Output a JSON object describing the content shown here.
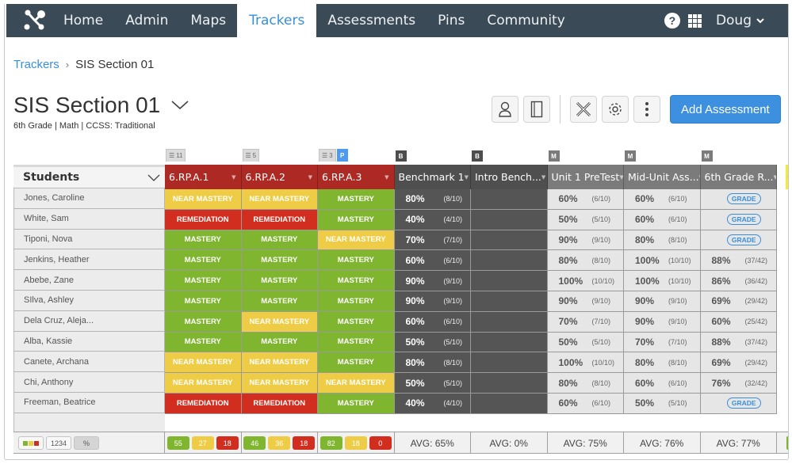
{
  "nav": {
    "items": [
      {
        "label": "Home",
        "active": false
      },
      {
        "label": "Admin",
        "active": false
      },
      {
        "label": "Maps",
        "active": false
      },
      {
        "label": "Trackers",
        "active": true
      },
      {
        "label": "Assessments",
        "active": false
      },
      {
        "label": "Pins",
        "active": false
      },
      {
        "label": "Community",
        "active": false
      }
    ],
    "help_icon": "?",
    "user_name": "Doug"
  },
  "breadcrumb": {
    "link": "Trackers",
    "separator": "›",
    "current": "SIS Section 01"
  },
  "page": {
    "title": "SIS Section 01",
    "subtitle": "6th Grade  |  Math  |  CCSS: Traditional"
  },
  "toolbar": {
    "icons": [
      "student-icon",
      "notebook-icon",
      "tools-icon",
      "gear-icon",
      "more-icon"
    ],
    "add_assessment_label": "Add Assessment"
  },
  "grid": {
    "students_header": "Students",
    "students": [
      "Jones, Caroline",
      "White, Sam",
      "Tiponi, Nova",
      "Jenkins, Heather",
      "Abebe, Zane",
      "SIlva, Ashley",
      "Dela Cruz, Aleja...",
      "Alba, Kassie",
      "Canete, Archana",
      "Chi, Anthony",
      "Freeman, Beatrice"
    ],
    "level_labels": {
      "m": "MASTERY",
      "n": "NEAR MASTERY",
      "r": "REMEDIATION"
    },
    "grade_label": "GRADE",
    "standards": [
      {
        "name": "6.RP.A.1",
        "count": "11",
        "pin": "",
        "levels": [
          "n",
          "r",
          "m",
          "m",
          "m",
          "m",
          "m",
          "m",
          "n",
          "n",
          "r"
        ],
        "summary": [
          "55",
          "27",
          "18"
        ]
      },
      {
        "name": "6.RP.A.2",
        "count": "5",
        "pin": "",
        "levels": [
          "n",
          "r",
          "m",
          "m",
          "m",
          "m",
          "n",
          "m",
          "n",
          "n",
          "r"
        ],
        "summary": [
          "46",
          "36",
          "18"
        ]
      },
      {
        "name": "6.RP.A.3",
        "count": "3",
        "pin": "P",
        "levels": [
          "m",
          "m",
          "n",
          "m",
          "m",
          "m",
          "m",
          "m",
          "m",
          "n",
          "m"
        ],
        "summary": [
          "82",
          "18",
          "0"
        ]
      }
    ],
    "assessments": [
      {
        "name": "Benchmark 1",
        "type": "B",
        "style": "bm",
        "avg": "AVG: 65%",
        "scores": [
          [
            "80%",
            "(8/10)"
          ],
          [
            "40%",
            "(4/10)"
          ],
          [
            "70%",
            "(7/10)"
          ],
          [
            "60%",
            "(6/10)"
          ],
          [
            "90%",
            "(9/10)"
          ],
          [
            "90%",
            "(9/10)"
          ],
          [
            "60%",
            "(6/10)"
          ],
          [
            "50%",
            "(5/10)"
          ],
          [
            "80%",
            "(8/10)"
          ],
          [
            "50%",
            "(5/10)"
          ],
          [
            "40%",
            "(4/10)"
          ]
        ]
      },
      {
        "name": "Intro Bench...",
        "type": "B",
        "style": "bm",
        "avg": "AVG: 0%",
        "scores": [
          null,
          null,
          null,
          null,
          null,
          null,
          null,
          null,
          null,
          null,
          null
        ]
      },
      {
        "name": "Unit 1 PreTest",
        "type": "M",
        "style": "mu",
        "avg": "AVG: 75%",
        "scores": [
          [
            "60%",
            "(6/10)"
          ],
          [
            "50%",
            "(5/10)"
          ],
          [
            "90%",
            "(9/10)"
          ],
          [
            "80%",
            "(8/10)"
          ],
          [
            "100%",
            "(10/10)"
          ],
          [
            "90%",
            "(9/10)"
          ],
          [
            "70%",
            "(7/10)"
          ],
          [
            "50%",
            "(5/10)"
          ],
          [
            "100%",
            "(10/10)"
          ],
          [
            "80%",
            "(8/10)"
          ],
          [
            "60%",
            "(6/10)"
          ]
        ]
      },
      {
        "name": "Mid-Unit Ass...",
        "type": "M",
        "style": "mu",
        "avg": "AVG: 76%",
        "scores": [
          [
            "60%",
            "(6/10)"
          ],
          [
            "60%",
            "(6/10)"
          ],
          [
            "80%",
            "(8/10)"
          ],
          [
            "100%",
            "(10/10)"
          ],
          [
            "100%",
            "(10/10)"
          ],
          [
            "90%",
            "(9/10)"
          ],
          [
            "90%",
            "(9/10)"
          ],
          [
            "70%",
            "(7/10)"
          ],
          [
            "80%",
            "(8/10)"
          ],
          [
            "60%",
            "(6/10)"
          ],
          [
            "50%",
            "(5/10)"
          ]
        ]
      },
      {
        "name": "6th Grade R...",
        "type": "M",
        "style": "mu",
        "avg": "AVG: 77%",
        "scores": [
          "GRADE",
          "GRADE",
          "GRADE",
          [
            "88%",
            "(37/42)"
          ],
          [
            "86%",
            "(36/42)"
          ],
          [
            "69%",
            "(29/42)"
          ],
          [
            "60%",
            "(25/42)"
          ],
          [
            "88%",
            "(37/42)"
          ],
          [
            "69%",
            "(29/42)"
          ],
          [
            "76%",
            "(32/42)"
          ],
          "GRADE"
        ]
      }
    ],
    "partial_next_column": "6",
    "footer_view_buttons": [
      "color-squares",
      "1234",
      "%"
    ]
  },
  "colors": {
    "mastery": "#7fb52f",
    "near_mastery": "#eecc45",
    "remediation": "#d12e20",
    "standard_header": "#ad2a24",
    "accent": "#3d8fe0"
  }
}
